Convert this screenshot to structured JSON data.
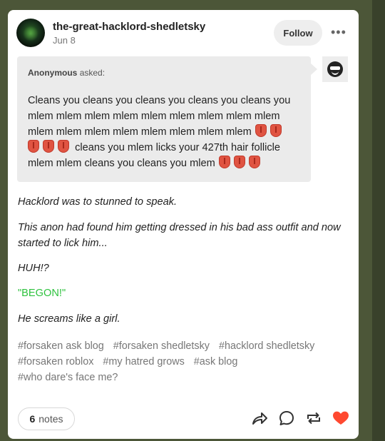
{
  "post": {
    "blog_name": "the-great-hacklord-shedletsky",
    "date": "Jun 8",
    "follow_label": "Follow",
    "more_label": "•••"
  },
  "ask": {
    "asker": "Anonymous",
    "asked_label": "asked:",
    "line1": "Cleans you cleans you cleans you cleans you cleans you",
    "line2": "mlem mlem mlem mlem mlem mlem mlem mlem mlem",
    "line3": "mlem mlem mlem mlem mlem mlem mlem mlem",
    "line4": "cleans you mlem licks your 427th hair follicle",
    "line5": "mlem mlem cleans you cleans you mlem"
  },
  "body": {
    "p1": "Hacklord was to stunned to speak.",
    "p2": "This anon had found him getting dressed in his bad ass outfit and now started to lick him...",
    "p3": "HUH!?",
    "p4": "\"BEGON!\"",
    "p5": "He screams like a girl."
  },
  "tags": [
    "#forsaken ask blog",
    "#forsaken shedletsky",
    "#hacklord shedletsky",
    "#forsaken roblox",
    "#my hatred grows",
    "#ask blog",
    "#who dare's face me?"
  ],
  "footer": {
    "notes_count": "6",
    "notes_label": "notes"
  },
  "colors": {
    "page_bg": "#4c5638",
    "highlight_green": "#2ec23e",
    "like_red": "#ff4930"
  },
  "icons": [
    "share-icon",
    "reply-icon",
    "reblog-icon",
    "like-heart-icon",
    "tongue-emoji",
    "sunglasses-avatar-icon"
  ]
}
